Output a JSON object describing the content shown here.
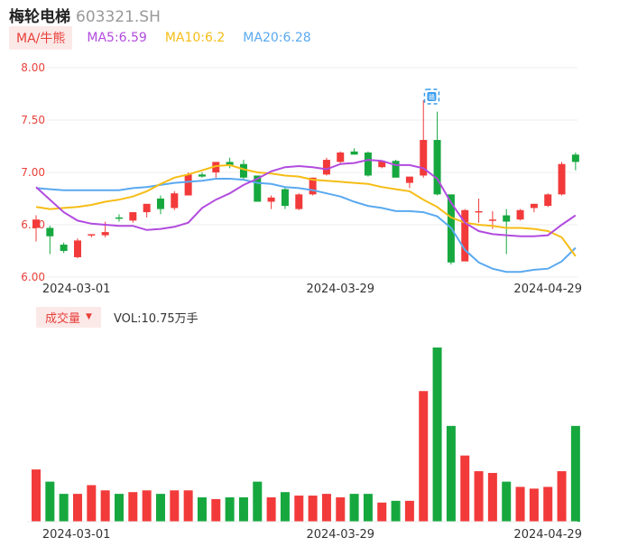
{
  "header": {
    "name": "梅轮电梯",
    "code": "603321.SH"
  },
  "ma_legend": {
    "toggle_label": "MA/牛熊",
    "ma5": {
      "label": "MA5:6.59",
      "color": "#b24bdf"
    },
    "ma10": {
      "label": "MA10:6.2",
      "color": "#f6bd16"
    },
    "ma20": {
      "label": "MA20:6.28",
      "color": "#5aa9f0"
    }
  },
  "volume_legend": {
    "toggle_label": "成交量",
    "arrow": "▼",
    "value_text": "VOL:10.75万手"
  },
  "colors": {
    "up": "#f23a3a",
    "down": "#16a83f",
    "grid": "#eeeeee",
    "axis_text": "#e8403a",
    "date_text": "#333333"
  },
  "marker": {
    "icon": "badge-icon",
    "label": "赣",
    "color": "#3a9ef0"
  },
  "chart_data": {
    "type": "candlestick",
    "price_axis": {
      "ylim": [
        6.0,
        8.0
      ],
      "ticks": [
        "8.00",
        "7.50",
        "7.00",
        "6.50",
        "6.00"
      ]
    },
    "date_ticks": [
      {
        "label": "2024-03-01",
        "index": 5
      },
      {
        "label": "2024-03-29",
        "index": 22
      },
      {
        "label": "2024-04-29",
        "index": 37
      }
    ],
    "candles": [
      {
        "o": 6.47,
        "h": 6.59,
        "l": 6.34,
        "c": 6.55
      },
      {
        "o": 6.47,
        "h": 6.49,
        "l": 6.22,
        "c": 6.39
      },
      {
        "o": 6.31,
        "h": 6.33,
        "l": 6.23,
        "c": 6.25
      },
      {
        "o": 6.19,
        "h": 6.37,
        "l": 6.18,
        "c": 6.35
      },
      {
        "o": 6.4,
        "h": 6.41,
        "l": 6.38,
        "c": 6.41
      },
      {
        "o": 6.4,
        "h": 6.53,
        "l": 6.38,
        "c": 6.43
      },
      {
        "o": 6.57,
        "h": 6.6,
        "l": 6.53,
        "c": 6.56
      },
      {
        "o": 6.54,
        "h": 6.62,
        "l": 6.52,
        "c": 6.62
      },
      {
        "o": 6.62,
        "h": 6.68,
        "l": 6.57,
        "c": 6.7
      },
      {
        "o": 6.75,
        "h": 6.78,
        "l": 6.6,
        "c": 6.65
      },
      {
        "o": 6.66,
        "h": 6.82,
        "l": 6.64,
        "c": 6.8
      },
      {
        "o": 6.78,
        "h": 7.0,
        "l": 6.78,
        "c": 6.98
      },
      {
        "o": 6.98,
        "h": 7.0,
        "l": 6.95,
        "c": 6.96
      },
      {
        "o": 7.0,
        "h": 7.1,
        "l": 6.95,
        "c": 7.1
      },
      {
        "o": 7.1,
        "h": 7.14,
        "l": 7.04,
        "c": 7.07
      },
      {
        "o": 7.08,
        "h": 7.12,
        "l": 6.93,
        "c": 6.95
      },
      {
        "o": 6.97,
        "h": 6.97,
        "l": 6.72,
        "c": 6.72
      },
      {
        "o": 6.72,
        "h": 6.78,
        "l": 6.65,
        "c": 6.76
      },
      {
        "o": 6.84,
        "h": 6.86,
        "l": 6.65,
        "c": 6.68
      },
      {
        "o": 6.65,
        "h": 6.8,
        "l": 6.64,
        "c": 6.79
      },
      {
        "o": 6.79,
        "h": 6.95,
        "l": 6.78,
        "c": 6.95
      },
      {
        "o": 6.98,
        "h": 7.14,
        "l": 6.97,
        "c": 7.12
      },
      {
        "o": 7.1,
        "h": 7.2,
        "l": 7.09,
        "c": 7.19
      },
      {
        "o": 7.2,
        "h": 7.23,
        "l": 7.17,
        "c": 7.17
      },
      {
        "o": 7.19,
        "h": 7.2,
        "l": 6.96,
        "c": 6.97
      },
      {
        "o": 7.05,
        "h": 7.11,
        "l": 7.04,
        "c": 7.11
      },
      {
        "o": 7.11,
        "h": 7.12,
        "l": 6.97,
        "c": 6.95
      },
      {
        "o": 6.9,
        "h": 6.9,
        "l": 6.85,
        "c": 6.96
      },
      {
        "o": 6.97,
        "h": 7.69,
        "l": 6.95,
        "c": 7.31
      },
      {
        "o": 7.31,
        "h": 7.58,
        "l": 6.78,
        "c": 6.79
      },
      {
        "o": 6.79,
        "h": 6.79,
        "l": 6.12,
        "c": 6.14
      },
      {
        "o": 6.15,
        "h": 6.65,
        "l": 6.15,
        "c": 6.64
      },
      {
        "o": 6.63,
        "h": 6.75,
        "l": 6.52,
        "c": 6.63
      },
      {
        "o": 6.55,
        "h": 6.63,
        "l": 6.46,
        "c": 6.55
      },
      {
        "o": 6.59,
        "h": 6.65,
        "l": 6.22,
        "c": 6.53
      },
      {
        "o": 6.55,
        "h": 6.65,
        "l": 6.54,
        "c": 6.64
      },
      {
        "o": 6.66,
        "h": 6.7,
        "l": 6.62,
        "c": 6.7
      },
      {
        "o": 6.68,
        "h": 6.8,
        "l": 6.67,
        "c": 6.79
      },
      {
        "o": 6.79,
        "h": 7.1,
        "l": 6.78,
        "c": 7.08
      },
      {
        "o": 7.17,
        "h": 7.19,
        "l": 7.02,
        "c": 7.1
      }
    ],
    "ma5": [
      6.86,
      6.74,
      6.62,
      6.54,
      6.51,
      6.5,
      6.49,
      6.49,
      6.45,
      6.46,
      6.48,
      6.52,
      6.66,
      6.74,
      6.8,
      6.88,
      6.94,
      7.01,
      7.05,
      7.06,
      7.05,
      7.03,
      7.08,
      7.09,
      7.12,
      7.11,
      7.07,
      7.07,
      7.04,
      6.94,
      6.71,
      6.52,
      6.44,
      6.41,
      6.4,
      6.39,
      6.39,
      6.4,
      6.5,
      6.59
    ],
    "ma10": [
      6.67,
      6.65,
      6.66,
      6.67,
      6.69,
      6.72,
      6.74,
      6.77,
      6.82,
      6.89,
      6.95,
      6.98,
      7.02,
      7.06,
      7.07,
      7.03,
      7.0,
      6.99,
      6.97,
      6.96,
      6.93,
      6.92,
      6.91,
      6.9,
      6.89,
      6.86,
      6.84,
      6.82,
      6.74,
      6.67,
      6.57,
      6.52,
      6.5,
      6.49,
      6.47,
      6.47,
      6.46,
      6.44,
      6.38,
      6.2
    ],
    "ma20": [
      6.85,
      6.84,
      6.83,
      6.83,
      6.83,
      6.83,
      6.83,
      6.85,
      6.86,
      6.88,
      6.9,
      6.91,
      6.92,
      6.94,
      6.94,
      6.93,
      6.9,
      6.89,
      6.86,
      6.85,
      6.83,
      6.8,
      6.77,
      6.72,
      6.68,
      6.66,
      6.63,
      6.63,
      6.62,
      6.58,
      6.47,
      6.26,
      6.14,
      6.08,
      6.05,
      6.05,
      6.07,
      6.08,
      6.15,
      6.28
    ],
    "volume": [
      0.3,
      0.23,
      0.16,
      0.16,
      0.21,
      0.18,
      0.16,
      0.17,
      0.18,
      0.16,
      0.18,
      0.18,
      0.14,
      0.13,
      0.14,
      0.14,
      0.23,
      0.14,
      0.17,
      0.15,
      0.15,
      0.16,
      0.14,
      0.16,
      0.16,
      0.11,
      0.12,
      0.12,
      0.75,
      1.0,
      0.55,
      0.38,
      0.29,
      0.28,
      0.23,
      0.2,
      0.19,
      0.2,
      0.29,
      0.55
    ]
  }
}
